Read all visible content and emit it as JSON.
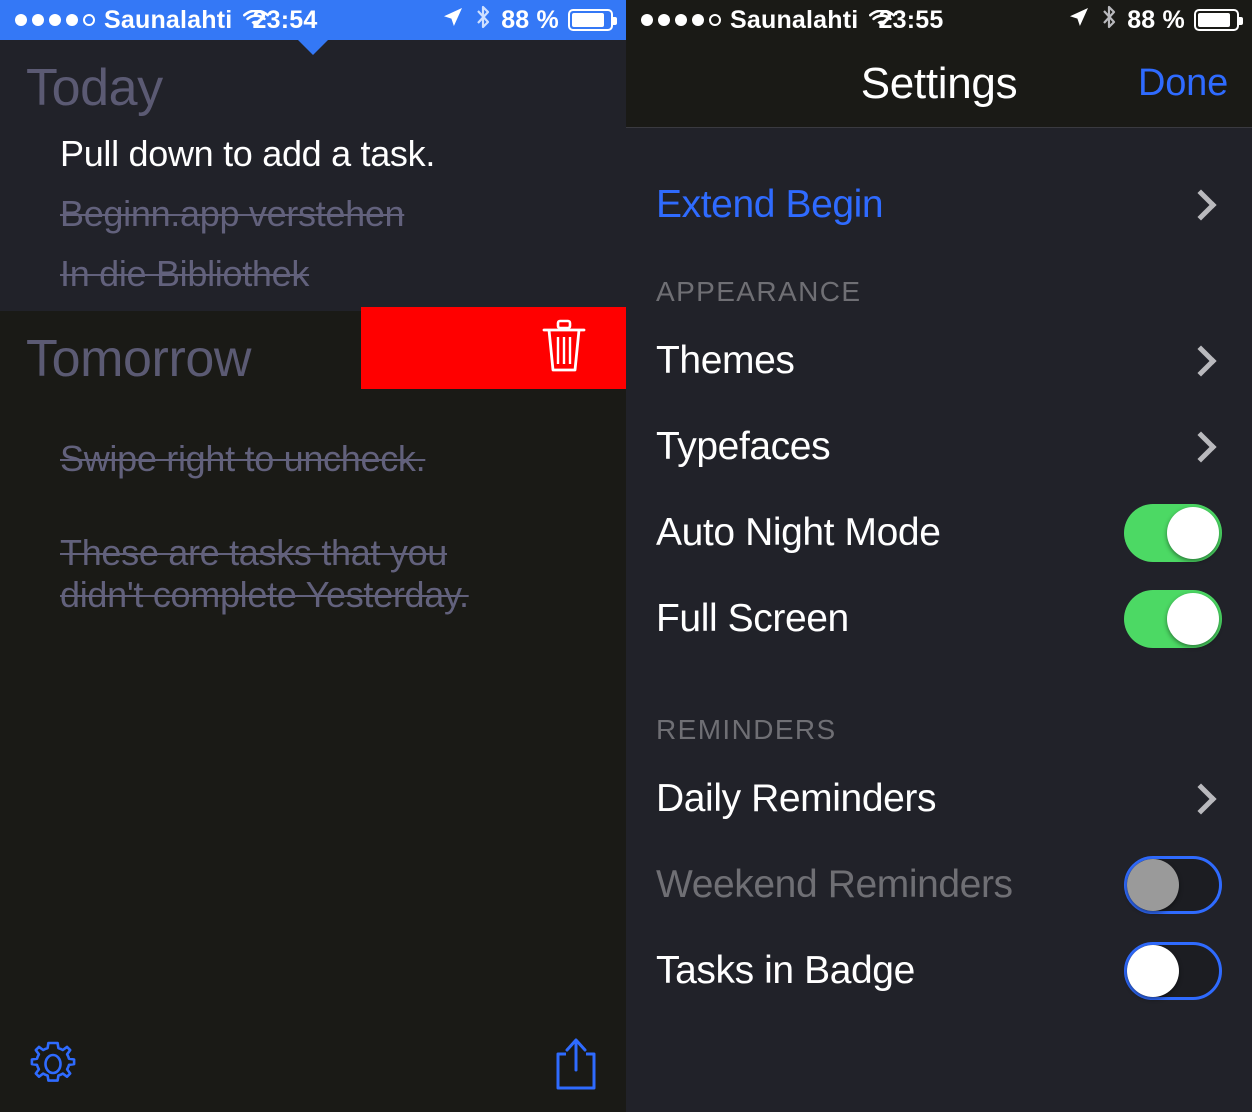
{
  "left": {
    "statusbar": {
      "carrier": "Saunalahti",
      "time": "23:54",
      "battery_percent": "88 %",
      "signal_filled": 4,
      "signal_hollow": 1,
      "wifi_icon": "wifi-icon",
      "location_icon": "location-arrow-icon",
      "bluetooth_icon": "bluetooth-icon",
      "battery_icon": "battery-icon",
      "bg_color": "#3478F6"
    },
    "sections": [
      {
        "heading": "Today",
        "tasks": [
          {
            "text": "Pull down to add a task.",
            "done": false
          },
          {
            "text": "Beginn.app verstehen",
            "done": true
          },
          {
            "text": "In die Bibliothek",
            "done": true
          }
        ]
      },
      {
        "heading": "Tomorrow",
        "tasks": [
          {
            "text": "Swipe right to uncheck.",
            "done": true
          },
          {
            "text": "These are tasks that you didn't complete Yesterday.",
            "done": true
          }
        ]
      }
    ],
    "swipe_action": {
      "label": "Delete",
      "icon": "trash-icon",
      "bg_color": "#FF0000"
    },
    "toolbar": {
      "settings_icon": "gear-icon",
      "share_icon": "share-icon",
      "accent_color": "#2f6bff"
    }
  },
  "right": {
    "statusbar": {
      "carrier": "Saunalahti",
      "time": "23:55",
      "battery_percent": "88 %",
      "signal_filled": 4,
      "signal_hollow": 1,
      "wifi_icon": "wifi-icon",
      "location_icon": "location-arrow-icon",
      "bluetooth_icon": "bluetooth-icon",
      "battery_icon": "battery-icon",
      "bg_color": "#1a1a16"
    },
    "navbar": {
      "title": "Settings",
      "done_label": "Done"
    },
    "rows": [
      {
        "label": "Extend Begin",
        "style": "link",
        "control": "chevron"
      }
    ],
    "sections": [
      {
        "title": "APPEARANCE",
        "rows": [
          {
            "label": "Themes",
            "style": "normal",
            "control": "chevron"
          },
          {
            "label": "Typefaces",
            "style": "normal",
            "control": "chevron"
          },
          {
            "label": "Auto Night Mode",
            "style": "normal",
            "control": "toggle",
            "toggle_state": "on"
          },
          {
            "label": "Full Screen",
            "style": "normal",
            "control": "toggle",
            "toggle_state": "on"
          }
        ]
      },
      {
        "title": "REMINDERS",
        "rows": [
          {
            "label": "Daily Reminders",
            "style": "normal",
            "control": "chevron"
          },
          {
            "label": "Weekend Reminders",
            "style": "dimmed",
            "control": "toggle",
            "toggle_state": "off-gray"
          },
          {
            "label": "Tasks in Badge",
            "style": "normal",
            "control": "toggle",
            "toggle_state": "off-white"
          }
        ]
      }
    ],
    "colors": {
      "accent": "#2f6bff",
      "toggle_on": "#4CD964",
      "background": "#212229",
      "navbar": "#1a1a16"
    }
  }
}
